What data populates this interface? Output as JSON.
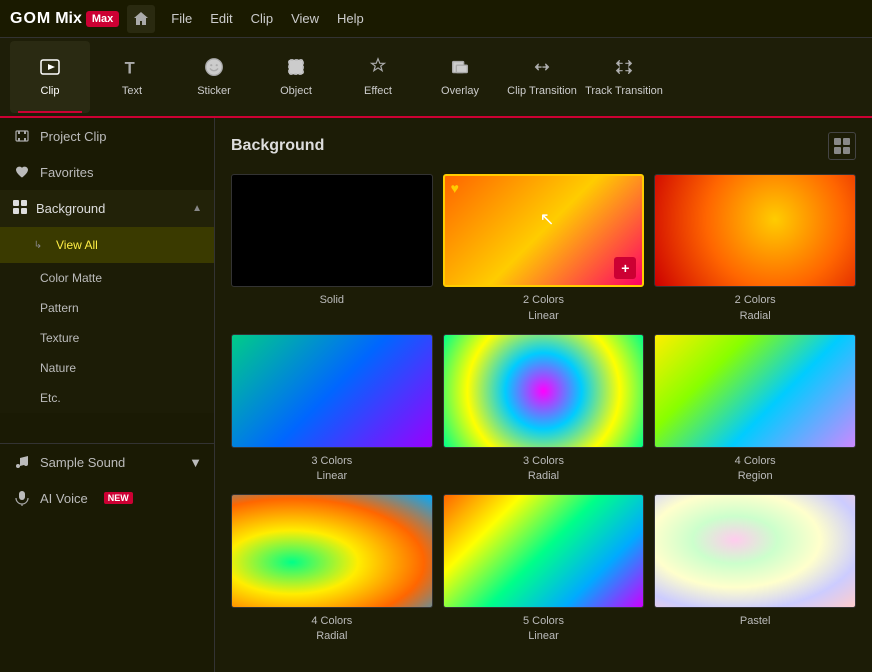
{
  "app": {
    "logo_gom": "GOM",
    "logo_mix": "Mix",
    "logo_max": "Max"
  },
  "titlebar": {
    "home_tooltip": "Home",
    "menus": [
      "File",
      "Edit",
      "Clip",
      "View",
      "Help"
    ]
  },
  "toolbar": {
    "items": [
      {
        "id": "clip",
        "label": "Clip",
        "active": true
      },
      {
        "id": "text",
        "label": "Text",
        "active": false
      },
      {
        "id": "sticker",
        "label": "Sticker",
        "active": false
      },
      {
        "id": "object",
        "label": "Object",
        "active": false
      },
      {
        "id": "effect",
        "label": "Effect",
        "active": false
      },
      {
        "id": "overlay",
        "label": "Overlay",
        "active": false
      },
      {
        "id": "clip-transition",
        "label": "Clip Transition",
        "active": false
      },
      {
        "id": "track-transition",
        "label": "Track Transition",
        "active": false
      }
    ]
  },
  "sidebar": {
    "sections": [
      {
        "id": "project-clip",
        "label": "Project Clip",
        "icon": "film",
        "type": "item"
      },
      {
        "id": "favorites",
        "label": "Favorites",
        "icon": "heart",
        "type": "item"
      },
      {
        "id": "background",
        "label": "Background",
        "icon": "grid",
        "type": "section",
        "expanded": true,
        "children": [
          {
            "id": "view-all",
            "label": "View All",
            "active": true
          },
          {
            "id": "color-matte",
            "label": "Color Matte"
          },
          {
            "id": "pattern",
            "label": "Pattern"
          },
          {
            "id": "texture",
            "label": "Texture"
          },
          {
            "id": "nature",
            "label": "Nature"
          },
          {
            "id": "etc",
            "label": "Etc."
          }
        ]
      }
    ],
    "bottom": [
      {
        "id": "sample-sound",
        "label": "Sample Sound",
        "icon": "music",
        "expandable": true
      },
      {
        "id": "ai-voice",
        "label": "AI Voice",
        "icon": "mic",
        "badge": "NEW"
      }
    ]
  },
  "content": {
    "title": "Background",
    "grid_toggle_label": "⊞",
    "items": [
      {
        "id": "solid",
        "label": "Solid",
        "sublabel": "",
        "thumb": "solid",
        "selected": false
      },
      {
        "id": "2colors-linear",
        "label": "2 Colors",
        "sublabel": "Linear",
        "thumb": "2color-linear",
        "selected": true,
        "favorite": true
      },
      {
        "id": "2colors-radial",
        "label": "2 Colors",
        "sublabel": "Radial",
        "thumb": "2color-radial",
        "selected": false
      },
      {
        "id": "3colors-linear",
        "label": "3 Colors",
        "sublabel": "Linear",
        "thumb": "3color-linear",
        "selected": false
      },
      {
        "id": "3colors-radial",
        "label": "3 Colors",
        "sublabel": "Radial",
        "thumb": "3color-radial",
        "selected": false
      },
      {
        "id": "4colors-region",
        "label": "4 Colors",
        "sublabel": "Region",
        "thumb": "4color-region",
        "selected": false
      },
      {
        "id": "4colors-radial",
        "label": "4 Colors",
        "sublabel": "Radial",
        "thumb": "4color-radial",
        "selected": false
      },
      {
        "id": "5colors-linear",
        "label": "5 Colors",
        "sublabel": "Linear",
        "thumb": "5color-linear",
        "selected": false
      },
      {
        "id": "pastel",
        "label": "Pastel",
        "sublabel": "",
        "thumb": "pastel",
        "selected": false
      }
    ]
  }
}
